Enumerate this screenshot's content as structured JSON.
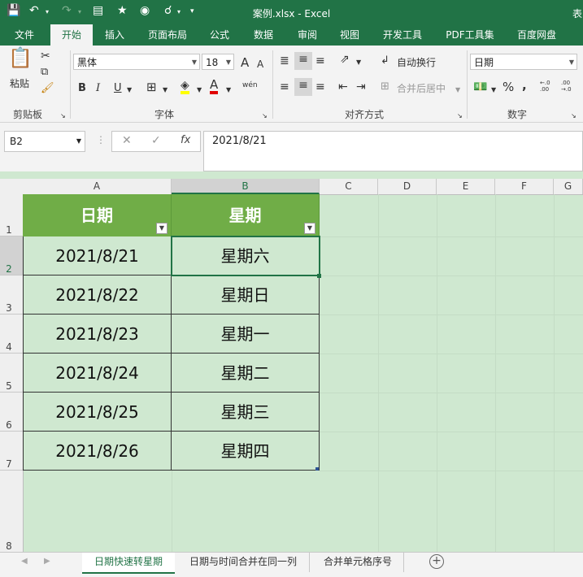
{
  "window": {
    "title": "案例.xlsx - Excel",
    "right_edge_text": "表"
  },
  "ribbon_tabs": [
    "文件",
    "开始",
    "插入",
    "页面布局",
    "公式",
    "数据",
    "审阅",
    "视图",
    "开发工具",
    "PDF工具集",
    "百度网盘"
  ],
  "ribbon": {
    "clipboard": {
      "paste_label": "粘贴",
      "group_label": "剪贴板"
    },
    "font": {
      "font_name": "黑体",
      "font_size": "18",
      "grow": "A",
      "shrink": "A",
      "bold": "B",
      "italic": "I",
      "underline": "U",
      "font_color_letter": "A",
      "phonetic": "wén",
      "group_label": "字体"
    },
    "alignment": {
      "wrap_text": "自动换行",
      "merge_center": "合并后居中",
      "group_label": "对齐方式"
    },
    "number": {
      "format": "日期",
      "percent": "%",
      "comma": ",",
      "inc_decimal": "←.0 .00",
      "dec_decimal": ".00 →.0",
      "group_label": "数字"
    }
  },
  "formula_bar": {
    "name_box": "B2",
    "formula": "2021/8/21"
  },
  "columns": [
    "A",
    "B",
    "C",
    "D",
    "E",
    "F",
    "G"
  ],
  "rows": [
    "1",
    "2",
    "3",
    "4",
    "5",
    "6",
    "7",
    "8"
  ],
  "table": {
    "headers": [
      "日期",
      "星期"
    ],
    "rows": [
      [
        "2021/8/21",
        "星期六"
      ],
      [
        "2021/8/22",
        "星期日"
      ],
      [
        "2021/8/23",
        "星期一"
      ],
      [
        "2021/8/24",
        "星期二"
      ],
      [
        "2021/8/25",
        "星期三"
      ],
      [
        "2021/8/26",
        "星期四"
      ]
    ]
  },
  "sheet_tabs": [
    "日期快速转星期",
    "日期与时间合并在同一列",
    "合并单元格序号"
  ],
  "colors": {
    "accent": "#217346",
    "header_fill": "#70ad47",
    "cell_fill": "#cfe8d0"
  }
}
